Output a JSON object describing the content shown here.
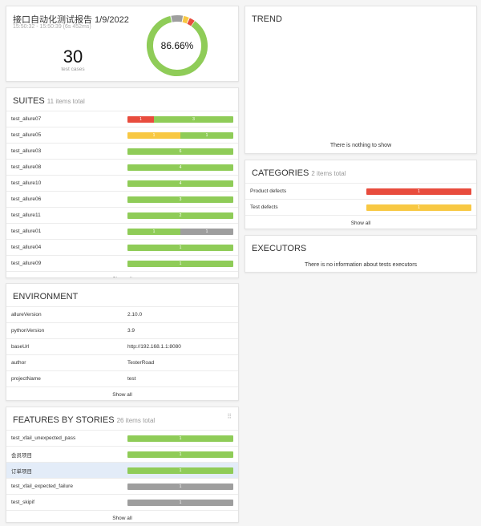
{
  "summary": {
    "title": "接口自动化测试报告 1/9/2022",
    "time_range": "15:50:32 - 15:50:39 (6s 452ms)",
    "test_count": "30",
    "test_count_label": "test cases",
    "pass_rate": "86.66%",
    "distribution": {
      "failed": 1,
      "broken": 1,
      "passed": 26,
      "skipped": 2
    }
  },
  "colors": {
    "failed": "#e84c3d",
    "broken": "#f8c843",
    "passed": "#8fcc58",
    "skipped": "#9e9e9e"
  },
  "suites": {
    "title": "SUITES",
    "subtitle": "11 items total",
    "items": [
      {
        "name": "test_allure07",
        "segments": [
          {
            "status": "failed",
            "count": 1
          },
          {
            "status": "passed",
            "count": 3
          }
        ]
      },
      {
        "name": "test_allure05",
        "segments": [
          {
            "status": "broken",
            "count": 1
          },
          {
            "status": "passed",
            "count": 1
          }
        ]
      },
      {
        "name": "test_allure03",
        "segments": [
          {
            "status": "passed",
            "count": 6
          }
        ]
      },
      {
        "name": "test_allure08",
        "segments": [
          {
            "status": "passed",
            "count": 4
          }
        ]
      },
      {
        "name": "test_allure10",
        "segments": [
          {
            "status": "passed",
            "count": 4
          }
        ]
      },
      {
        "name": "test_allure06",
        "segments": [
          {
            "status": "passed",
            "count": 3
          }
        ]
      },
      {
        "name": "test_allure11",
        "segments": [
          {
            "status": "passed",
            "count": 2
          }
        ]
      },
      {
        "name": "test_allure01",
        "segments": [
          {
            "status": "passed",
            "count": 1
          },
          {
            "status": "skipped",
            "count": 1
          }
        ]
      },
      {
        "name": "test_allure04",
        "segments": [
          {
            "status": "passed",
            "count": 1
          }
        ]
      },
      {
        "name": "test_allure09",
        "segments": [
          {
            "status": "passed",
            "count": 1
          }
        ]
      }
    ],
    "show_all": "Show all"
  },
  "trend": {
    "title": "TREND",
    "empty_message": "There is nothing to show"
  },
  "categories": {
    "title": "CATEGORIES",
    "subtitle": "2 items total",
    "items": [
      {
        "name": "Product defects",
        "segments": [
          {
            "status": "failed",
            "count": 1
          }
        ]
      },
      {
        "name": "Test defects",
        "segments": [
          {
            "status": "broken",
            "count": 1
          }
        ]
      }
    ],
    "show_all": "Show all"
  },
  "executors": {
    "title": "EXECUTORS",
    "empty_message": "There is no information about tests executors"
  },
  "environment": {
    "title": "ENVIRONMENT",
    "items": [
      {
        "key": "allureVersion",
        "value": "2.10.0"
      },
      {
        "key": "pythonVersion",
        "value": "3.9"
      },
      {
        "key": "baseUrl",
        "value": "http://192.168.1.1:8080"
      },
      {
        "key": "author",
        "value": "TesterRoad"
      },
      {
        "key": "projectName",
        "value": "test"
      }
    ],
    "show_all": "Show all"
  },
  "features": {
    "title": "FEATURES BY STORIES",
    "subtitle": "26 items total",
    "items": [
      {
        "name": "test_xfail_unexpected_pass",
        "segments": [
          {
            "status": "passed",
            "count": 1
          }
        ]
      },
      {
        "name": "会员项目",
        "segments": [
          {
            "status": "passed",
            "count": 1
          }
        ]
      },
      {
        "name": "订单项目",
        "segments": [
          {
            "status": "passed",
            "count": 1
          }
        ],
        "highlight": true
      },
      {
        "name": "test_xfail_expected_failure",
        "segments": [
          {
            "status": "skipped",
            "count": 1
          }
        ]
      },
      {
        "name": "test_skipif",
        "segments": [
          {
            "status": "skipped",
            "count": 1
          }
        ]
      }
    ],
    "show_all": "Show all"
  }
}
